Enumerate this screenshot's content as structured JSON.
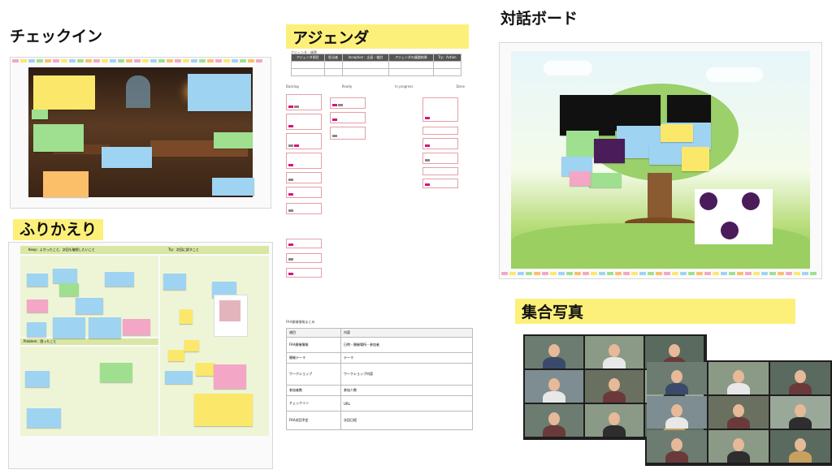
{
  "headings": {
    "checkin": "チェックイン",
    "furikaeri": "ふりかえり",
    "agenda": "アジェンダ",
    "taiwa": "対話ボード",
    "photo": "集合写真"
  },
  "furikaeri": {
    "col_keep": "Keep：よかったこと、次回も継続したいこと",
    "col_try": "Try：次回に試すこと",
    "row_problem": "Problem：困ったこと"
  },
  "agenda": {
    "small_title": "アジェンダ・議題",
    "columns": [
      "Backlog",
      "Ready",
      "In progress",
      "Done"
    ],
    "table_headers": [
      "アジェンダ項目",
      "担当者",
      "Inception：企画・検討",
      "アジェンダの議論結果",
      "Try：Action"
    ],
    "info_title": "FAA開催情報まとめ",
    "info_rows": [
      [
        "項目",
        "内容"
      ],
      [
        "FAA開催情報",
        "日時・開催場所・参加者"
      ],
      [
        "開催テーマ",
        "テーマ"
      ],
      [
        "ワークショップ",
        "ワークショップ内容"
      ],
      [
        "参加者数",
        "参加人数"
      ],
      [
        "チェックイン",
        "URL"
      ],
      [
        "FAA次回予定",
        "次回日程"
      ]
    ]
  },
  "colors": {
    "highlight": "#fdf07a",
    "pink": "#f4a6c6",
    "yellow": "#fbe86a",
    "blue": "#9fd3f2",
    "green": "#9ee08f",
    "orange": "#fbbf6a",
    "furikaeri_bg": "#eef5d6"
  }
}
